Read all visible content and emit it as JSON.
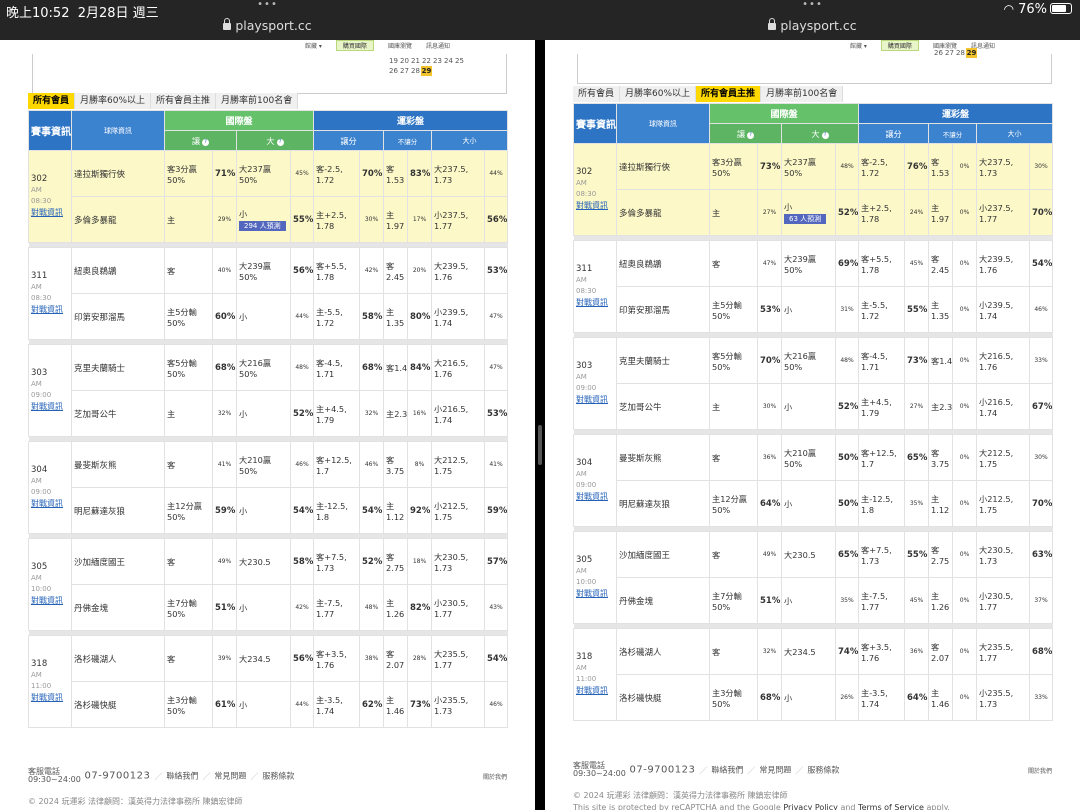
{
  "status": {
    "time": "晚上10:52",
    "date": "2月28日 週三",
    "battery": "76%",
    "battery_level": 0.76
  },
  "url": "playsport.cc",
  "subnav": {
    "items": [
      "館藏 ▾",
      "購買國際",
      "國庫瀏覽",
      "訊息通知"
    ]
  },
  "calendar": {
    "rows": [
      [
        "19",
        "20",
        "21",
        "22",
        "23",
        "24",
        "25"
      ],
      [
        "26",
        "27",
        "28",
        "29"
      ]
    ],
    "today": "29"
  },
  "tabs": [
    "所有會員",
    "月勝率60%以上",
    "所有會員主推",
    "月勝率前100名會"
  ],
  "headers": {
    "event": "賽事資訊",
    "team": "球隊資訊",
    "intl": "國際盤",
    "sport": "運彩盤",
    "rang": "讓",
    "da": "大",
    "rangfen": "讓分",
    "burangfen": "不讓分",
    "daxiao": "大小",
    "q": "?"
  },
  "panes": [
    {
      "active_tab": 0,
      "predict": "294 人預測",
      "games": [
        {
          "id": "302",
          "ampm": "AM",
          "time": "08:30",
          "link": "對戰資訊",
          "highlight": true,
          "rows": [
            [
              "達拉斯獨行俠",
              "客3分贏\n50%",
              "71%",
              "大237贏\n50%",
              "45%",
              "客-2.5,\n1.72",
              "70%",
              "客\n1.53",
              "83%",
              "大237.5,\n1.73",
              "44%"
            ],
            [
              "多倫多暴龍",
              "主",
              "29%",
              "小",
              "55%",
              "主+2.5,\n1.78",
              "30%",
              "主\n1.97",
              "17%",
              "小237.5,\n1.77",
              "56%"
            ]
          ]
        },
        {
          "id": "311",
          "ampm": "AM",
          "time": "08:30",
          "link": "對戰資訊",
          "highlight": false,
          "rows": [
            [
              "紐奧良鵜鶘",
              "客",
              "40%",
              "大239贏\n50%",
              "56%",
              "客+5.5,\n1.78",
              "42%",
              "客\n2.45",
              "20%",
              "大239.5,\n1.76",
              "53%"
            ],
            [
              "印第安那溜馬",
              "主5分輸\n50%",
              "60%",
              "小",
              "44%",
              "主-5.5,\n1.72",
              "58%",
              "主\n1.35",
              "80%",
              "小239.5,\n1.74",
              "47%"
            ]
          ]
        },
        {
          "id": "303",
          "ampm": "AM",
          "time": "09:00",
          "link": "對戰資訊",
          "highlight": false,
          "rows": [
            [
              "克里夫蘭騎士",
              "客5分輸\n50%",
              "68%",
              "大216贏\n50%",
              "48%",
              "客-4.5,\n1.71",
              "68%",
              "客1.4",
              "84%",
              "大216.5,\n1.76",
              "47%"
            ],
            [
              "芝加哥公牛",
              "主",
              "32%",
              "小",
              "52%",
              "主+4.5,\n1.79",
              "32%",
              "主2.3",
              "16%",
              "小216.5,\n1.74",
              "53%"
            ]
          ]
        },
        {
          "id": "304",
          "ampm": "AM",
          "time": "09:00",
          "link": "對戰資訊",
          "highlight": false,
          "rows": [
            [
              "曼斐斯灰熊",
              "客",
              "41%",
              "大210贏\n50%",
              "46%",
              "客+12.5,\n1.7",
              "46%",
              "客\n3.75",
              "8%",
              "大212.5,\n1.75",
              "41%"
            ],
            [
              "明尼蘇達灰狼",
              "主12分贏\n50%",
              "59%",
              "小",
              "54%",
              "主-12.5,\n1.8",
              "54%",
              "主\n1.12",
              "92%",
              "小212.5,\n1.75",
              "59%"
            ]
          ]
        },
        {
          "id": "305",
          "ampm": "AM",
          "time": "10:00",
          "link": "對戰資訊",
          "highlight": false,
          "rows": [
            [
              "沙加緬度國王",
              "客",
              "49%",
              "大230.5",
              "58%",
              "客+7.5,\n1.73",
              "52%",
              "客\n2.75",
              "18%",
              "大230.5,\n1.73",
              "57%"
            ],
            [
              "丹佛金塊",
              "主7分輸\n50%",
              "51%",
              "小",
              "42%",
              "主-7.5,\n1.77",
              "48%",
              "主\n1.26",
              "82%",
              "小230.5,\n1.77",
              "43%"
            ]
          ]
        },
        {
          "id": "318",
          "ampm": "AM",
          "time": "11:00",
          "link": "對戰資訊",
          "highlight": false,
          "rows": [
            [
              "洛杉磯湖人",
              "客",
              "39%",
              "大234.5",
              "56%",
              "客+3.5,\n1.76",
              "38%",
              "客\n2.07",
              "28%",
              "大235.5,\n1.77",
              "54%"
            ],
            [
              "洛杉磯快艇",
              "主3分輸\n50%",
              "61%",
              "小",
              "44%",
              "主-3.5,\n1.74",
              "62%",
              "主\n1.46",
              "73%",
              "小235.5,\n1.73",
              "46%"
            ]
          ]
        }
      ]
    },
    {
      "active_tab": 2,
      "predict": "63 人預測",
      "games": [
        {
          "id": "302",
          "ampm": "AM",
          "time": "08:30",
          "link": "對戰資訊",
          "highlight": true,
          "rows": [
            [
              "達拉斯獨行俠",
              "客3分贏\n50%",
              "73%",
              "大237贏\n50%",
              "48%",
              "客-2.5,\n1.72",
              "76%",
              "客\n1.53",
              "0%",
              "大237.5,\n1.73",
              "30%"
            ],
            [
              "多倫多暴龍",
              "主",
              "27%",
              "小",
              "52%",
              "主+2.5,\n1.78",
              "24%",
              "主\n1.97",
              "0%",
              "小237.5,\n1.77",
              "70%"
            ]
          ]
        },
        {
          "id": "311",
          "ampm": "AM",
          "time": "08:30",
          "link": "對戰資訊",
          "highlight": false,
          "rows": [
            [
              "紐奧良鵜鶘",
              "客",
              "47%",
              "大239贏\n50%",
              "69%",
              "客+5.5,\n1.78",
              "45%",
              "客\n2.45",
              "0%",
              "大239.5,\n1.76",
              "54%"
            ],
            [
              "印第安那溜馬",
              "主5分輸\n50%",
              "53%",
              "小",
              "31%",
              "主-5.5,\n1.72",
              "55%",
              "主\n1.35",
              "0%",
              "小239.5,\n1.74",
              "46%"
            ]
          ]
        },
        {
          "id": "303",
          "ampm": "AM",
          "time": "09:00",
          "link": "對戰資訊",
          "highlight": false,
          "rows": [
            [
              "克里夫蘭騎士",
              "客5分輸\n50%",
              "70%",
              "大216贏\n50%",
              "48%",
              "客-4.5,\n1.71",
              "73%",
              "客1.4",
              "0%",
              "大216.5,\n1.76",
              "33%"
            ],
            [
              "芝加哥公牛",
              "主",
              "30%",
              "小",
              "52%",
              "主+4.5,\n1.79",
              "27%",
              "主2.3",
              "0%",
              "小216.5,\n1.74",
              "67%"
            ]
          ]
        },
        {
          "id": "304",
          "ampm": "AM",
          "time": "09:00",
          "link": "對戰資訊",
          "highlight": false,
          "rows": [
            [
              "曼斐斯灰熊",
              "客",
              "36%",
              "大210贏\n50%",
              "50%",
              "客+12.5,\n1.7",
              "65%",
              "客\n3.75",
              "0%",
              "大212.5,\n1.75",
              "30%"
            ],
            [
              "明尼蘇達灰狼",
              "主12分贏\n50%",
              "64%",
              "小",
              "50%",
              "主-12.5,\n1.8",
              "35%",
              "主\n1.12",
              "0%",
              "小212.5,\n1.75",
              "70%"
            ]
          ]
        },
        {
          "id": "305",
          "ampm": "AM",
          "time": "10:00",
          "link": "對戰資訊",
          "highlight": false,
          "rows": [
            [
              "沙加緬度國王",
              "客",
              "49%",
              "大230.5",
              "65%",
              "客+7.5,\n1.73",
              "55%",
              "客\n2.75",
              "0%",
              "大230.5,\n1.73",
              "63%"
            ],
            [
              "丹佛金塊",
              "主7分輸\n50%",
              "51%",
              "小",
              "35%",
              "主-7.5,\n1.77",
              "45%",
              "主\n1.26",
              "0%",
              "小230.5,\n1.77",
              "37%"
            ]
          ]
        },
        {
          "id": "318",
          "ampm": "AM",
          "time": "11:00",
          "link": "對戰資訊",
          "highlight": false,
          "rows": [
            [
              "洛杉磯湖人",
              "客",
              "32%",
              "大234.5",
              "74%",
              "客+3.5,\n1.76",
              "36%",
              "客\n2.07",
              "0%",
              "大235.5,\n1.77",
              "68%"
            ],
            [
              "洛杉磯快艇",
              "主3分輸\n50%",
              "68%",
              "小",
              "26%",
              "主-3.5,\n1.74",
              "64%",
              "主\n1.46",
              "0%",
              "小235.5,\n1.73",
              "33%"
            ]
          ]
        }
      ]
    }
  ],
  "footer": {
    "service_label": "客服電話",
    "service_hours": "09:30~24:00",
    "tel": "07-9700123",
    "links": [
      "聯絡我們",
      "常見問題",
      "服務條款"
    ],
    "about": "關於我們",
    "copyright": "© 2024 玩運彩 法律顧問：漢英得力法律事務所 陳鎮宏律師",
    "recaptcha_prefix": "This site is protected by reCAPTCHA and the Google",
    "privacy": "Privacy Policy",
    "and": "and",
    "terms": "Terms of Service",
    "apply": "apply."
  }
}
